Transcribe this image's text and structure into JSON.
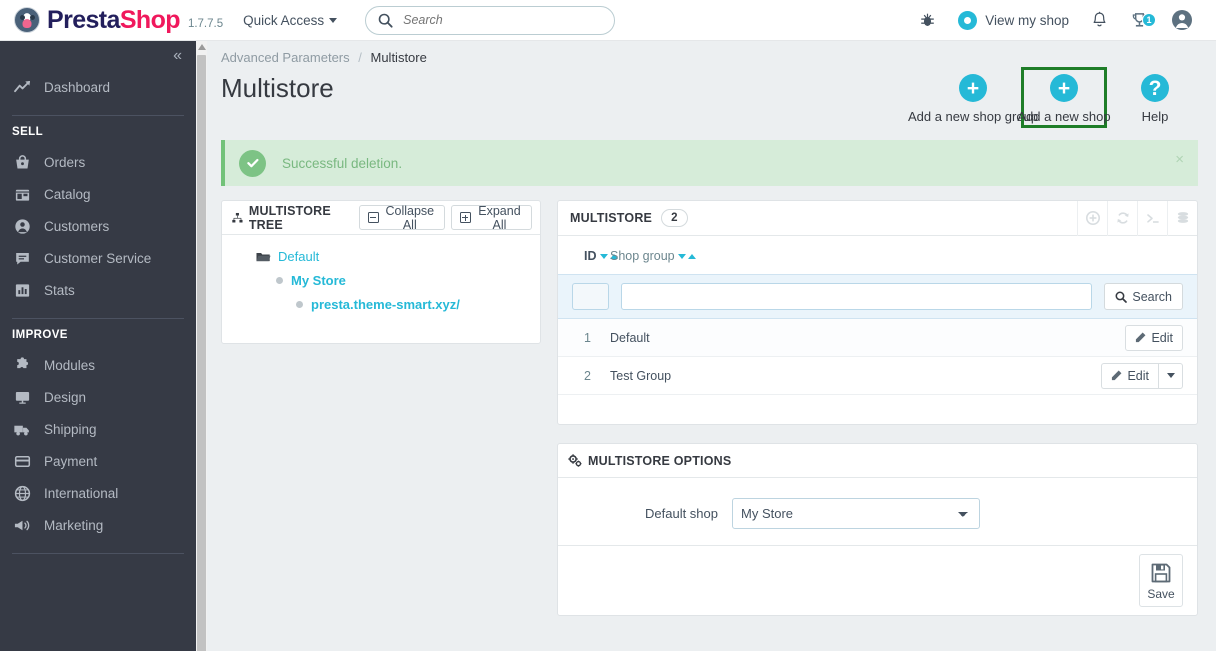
{
  "header": {
    "brand_prefix": "Presta",
    "brand_suffix": "Shop",
    "version": "1.7.7.5",
    "quick_access": "Quick Access",
    "search_placeholder": "Search",
    "search_value": "",
    "view_shop": "View my shop",
    "notification_badge": "1",
    "icons": {
      "bug": "bug-icon",
      "eye": "eye-icon",
      "bell": "bell-icon",
      "trophy": "trophy-icon",
      "account": "account-icon"
    },
    "accent_color": "#25b9d7",
    "brand_pink": "#f0185c",
    "brand_navy": "#231f5c"
  },
  "sidebar": {
    "collapse_label": "«",
    "dashboard": {
      "label": "Dashboard",
      "icon": "chart-line-icon"
    },
    "sections": [
      {
        "title": "SELL",
        "items": [
          {
            "label": "Orders",
            "icon": "basket-icon"
          },
          {
            "label": "Catalog",
            "icon": "store-icon"
          },
          {
            "label": "Customers",
            "icon": "user-circle-icon"
          },
          {
            "label": "Customer Service",
            "icon": "chat-icon"
          },
          {
            "label": "Stats",
            "icon": "bar-chart-icon"
          }
        ]
      },
      {
        "title": "IMPROVE",
        "items": [
          {
            "label": "Modules",
            "icon": "puzzle-icon"
          },
          {
            "label": "Design",
            "icon": "monitor-icon"
          },
          {
            "label": "Shipping",
            "icon": "truck-icon"
          },
          {
            "label": "Payment",
            "icon": "credit-card-icon"
          },
          {
            "label": "International",
            "icon": "globe-icon"
          },
          {
            "label": "Marketing",
            "icon": "megaphone-icon"
          }
        ]
      }
    ]
  },
  "breadcrumb": {
    "parent": "Advanced Parameters",
    "separator": "/",
    "current": "Multistore"
  },
  "page": {
    "title": "Multistore",
    "actions": [
      {
        "label": "Add a new shop group",
        "icon": "plus-circle-icon",
        "highlighted": false
      },
      {
        "label": "Add a new shop",
        "icon": "plus-circle-icon",
        "highlighted": true
      },
      {
        "label": "Help",
        "icon": "question-circle-icon",
        "highlighted": false
      }
    ],
    "highlight_color": "#1e7d28"
  },
  "alert": {
    "text": "Successful deletion.",
    "close_label": "×",
    "type": "success",
    "color": "#72c279"
  },
  "tree_panel": {
    "title": "MULTISTORE TREE",
    "collapse_all": "Collapse All",
    "expand_all": "Expand All",
    "nodes": [
      {
        "label": "Default",
        "level": 1,
        "type": "group"
      },
      {
        "label": "My Store",
        "level": 2,
        "type": "shop"
      },
      {
        "label": "presta.theme-smart.xyz/",
        "level": 3,
        "type": "url"
      }
    ]
  },
  "grid": {
    "title": "MULTISTORE",
    "count": "2",
    "tools": [
      {
        "name": "add-icon"
      },
      {
        "name": "refresh-icon"
      },
      {
        "name": "console-icon"
      },
      {
        "name": "database-icon"
      }
    ],
    "columns": [
      {
        "label": "ID",
        "sortable": true
      },
      {
        "label": "Shop group",
        "sortable": true
      }
    ],
    "filters": {
      "id_value": "",
      "name_value": "",
      "search_label": "Search"
    },
    "rows": [
      {
        "id": "1",
        "name": "Default",
        "action": "Edit",
        "has_dropdown": false
      },
      {
        "id": "2",
        "name": "Test Group",
        "action": "Edit",
        "has_dropdown": true
      }
    ]
  },
  "options_panel": {
    "title": "MULTISTORE OPTIONS",
    "default_shop_label": "Default shop",
    "default_shop_value": "My Store",
    "default_shop_options": [
      "My Store"
    ],
    "save_label": "Save"
  }
}
